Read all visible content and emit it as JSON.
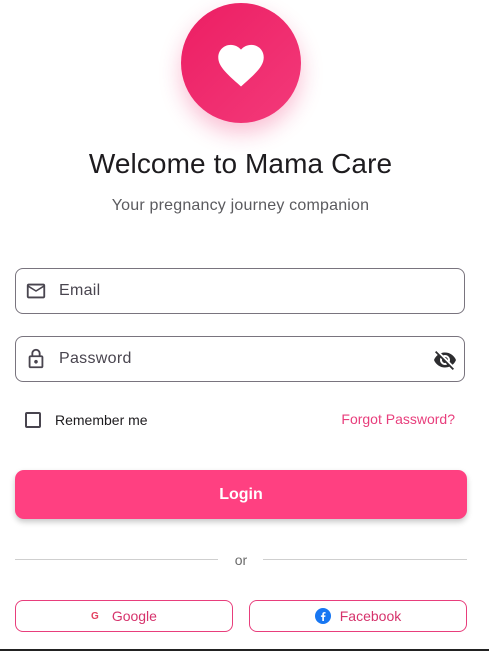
{
  "app": {
    "title": "Welcome to Mama Care",
    "subtitle": "Your pregnancy journey companion",
    "logo_icon": "heart-icon"
  },
  "form": {
    "email": {
      "placeholder": "Email",
      "value": "",
      "icon": "mail-icon"
    },
    "password": {
      "placeholder": "Password",
      "value": "",
      "icon": "lock-icon",
      "toggle_icon": "visibility-off-icon"
    },
    "remember_me": {
      "label": "Remember me",
      "checked": false
    },
    "forgot_password_label": "Forgot Password?",
    "login_label": "Login"
  },
  "divider": {
    "label": "or"
  },
  "social": {
    "google_label": "Google",
    "google_glyph": "G",
    "facebook_label": "Facebook"
  },
  "colors": {
    "primary": "#ff4081",
    "logo_gradient_start": "#ec1e63",
    "logo_gradient_end": "#f33a7a",
    "link": "#e83e7c",
    "facebook_blue": "#1877f2"
  }
}
